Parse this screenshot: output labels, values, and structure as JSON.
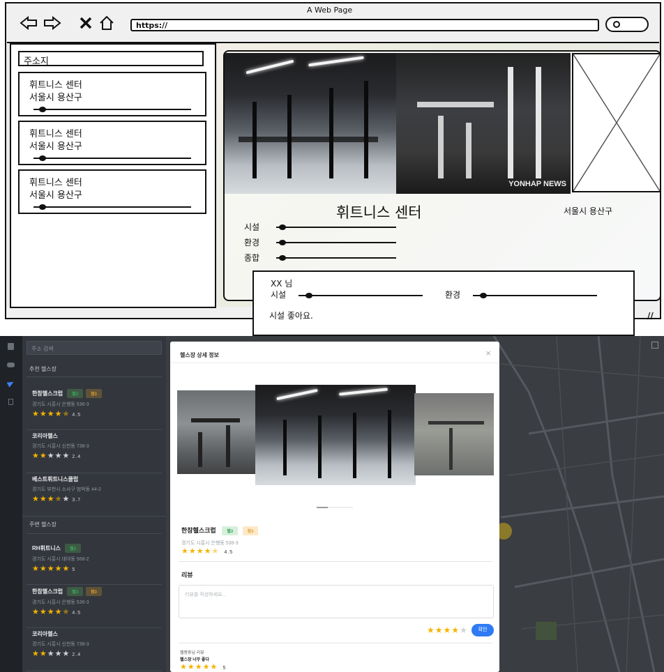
{
  "wireframe": {
    "browser": {
      "title": "A Web Page",
      "url": "https://",
      "nav_icons": [
        "back-arrow-icon",
        "forward-arrow-icon",
        "close-x-icon",
        "home-icon"
      ]
    },
    "sidebar": {
      "search_label": "주소지",
      "cards": [
        {
          "name": "휘트니스 센터",
          "address": "서울시 용산구"
        },
        {
          "name": "휘트니스 센터",
          "address": "서울시 용산구"
        },
        {
          "name": "휘트니스 센터",
          "address": "서울시 용산구"
        }
      ]
    },
    "detail": {
      "title": "휘트니스 센터",
      "address": "서울시 용산구",
      "ratings": [
        "시설",
        "환경",
        "종합"
      ],
      "photo_watermark": "YONHAP NEWS"
    },
    "review": {
      "user": "XX 님",
      "label_facility": "시설",
      "label_environment": "환경",
      "text": "시설 좋아요."
    }
  },
  "app": {
    "sidebar": {
      "search_placeholder": "주소 검색",
      "recommended_title": "추천 헬스장",
      "nearby_title": "주변 헬스장",
      "recommended": [
        {
          "name": "한참헬스크럽",
          "tags": [
            "헬3",
            "점3"
          ],
          "address": "경기도 시흥시 은행동 536-3",
          "rating": 4.5,
          "rating_text": "4.5"
        },
        {
          "name": "코리아헬스",
          "tags": [],
          "address": "경기도 시흥시 신천동 738-3",
          "rating": 2.4,
          "rating_text": "2.4"
        },
        {
          "name": "베스트휘트니스클럽",
          "tags": [],
          "address": "경기도 부천시 소사구 범박동 44-2",
          "rating": 3.7,
          "rating_text": "3.7"
        }
      ],
      "nearby": [
        {
          "name": "RH휘트니스",
          "tags": [
            "헬3"
          ],
          "address": "경기도 시흥시 대야동 568-2",
          "rating": 5,
          "rating_text": "5"
        },
        {
          "name": "한참헬스크럽",
          "tags": [
            "헬3",
            "점3"
          ],
          "address": "경기도 시흥시 은행동 536-3",
          "rating": 4.5,
          "rating_text": "4.5"
        },
        {
          "name": "코리아헬스",
          "tags": [],
          "address": "경기도 시흥시 신천동 738-3",
          "rating": 2.4,
          "rating_text": "2.4"
        }
      ]
    },
    "modal": {
      "title": "헬스장 상세 정보",
      "close": "×",
      "gym_name": "한참헬스크럽",
      "tags": [
        "헬3",
        "점3"
      ],
      "address": "경기도 시흥시 은행동 536-3",
      "rating": 4.5,
      "rating_text": "4.5",
      "review_heading": "리뷰",
      "review_placeholder": "리뷰를 작성하세요...",
      "review_rating": 4,
      "confirm_button": "확인",
      "latest_review_user": "헬짱휴님 리뷰",
      "latest_review_text": "헬스장 너무 좋다",
      "latest_review_rating": 5,
      "latest_review_rating_text": "5"
    },
    "map_fullscreen_icon": "expand-icon",
    "rail_icons": [
      "doc-icon",
      "car-icon",
      "send-icon",
      "file-icon"
    ]
  }
}
